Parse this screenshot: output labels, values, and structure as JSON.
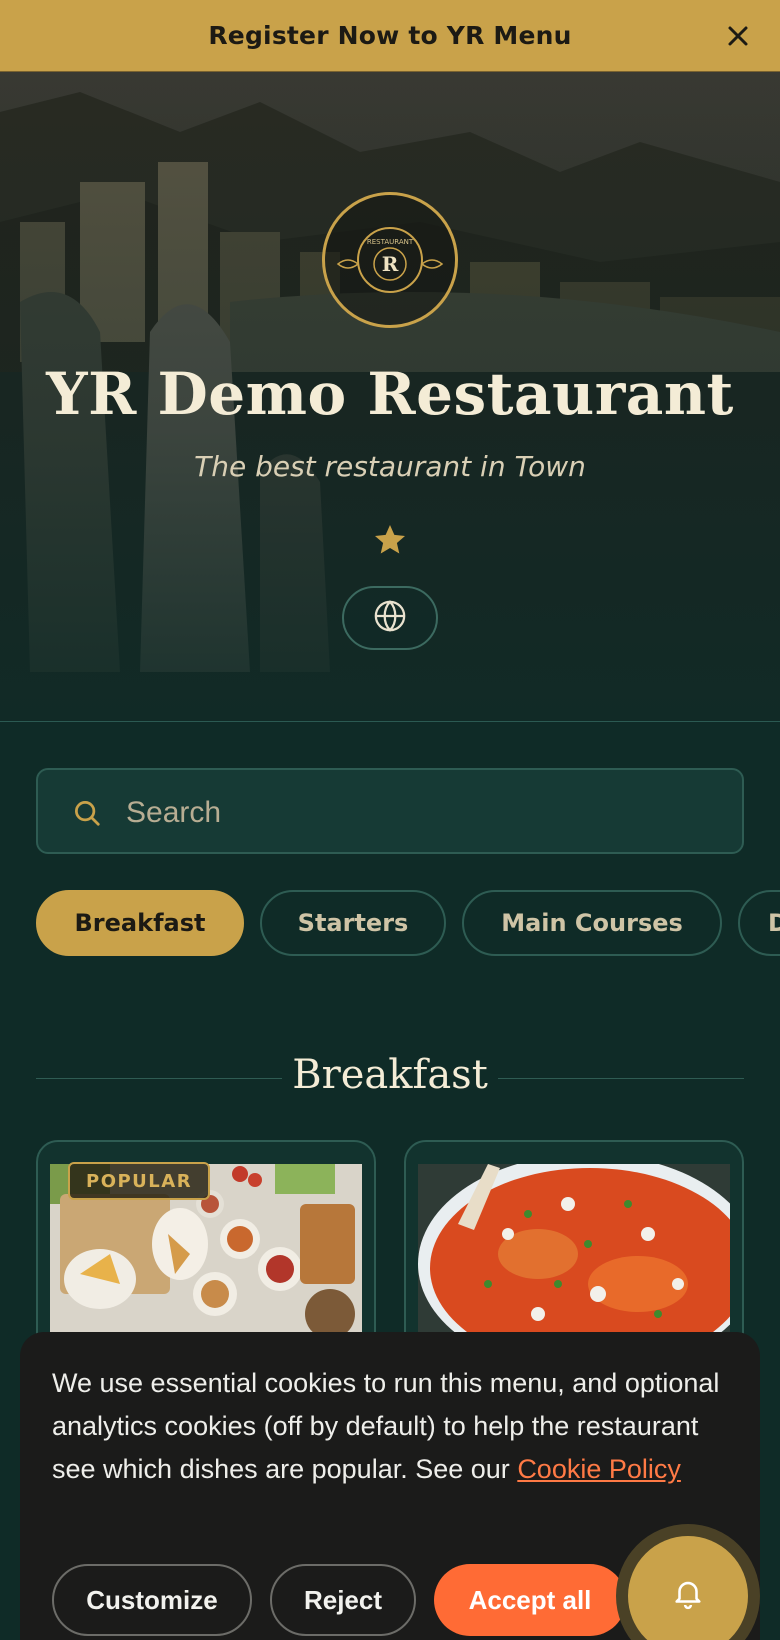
{
  "banner": {
    "text": "Register Now to YR Menu",
    "close_icon": "close-icon"
  },
  "hero": {
    "logo_text": "RESTAURANT",
    "logo_letter": "R",
    "title": "YR Demo Restaurant",
    "subtitle": "The best restaurant in Town",
    "star_icon": "star-icon",
    "language_icon": "globe-icon"
  },
  "search": {
    "placeholder": "Search",
    "value": ""
  },
  "categories": [
    {
      "label": "Breakfast",
      "active": true
    },
    {
      "label": "Starters",
      "active": false
    },
    {
      "label": "Main Courses",
      "active": false
    },
    {
      "label": "D",
      "active": false
    }
  ],
  "section": {
    "title": "Breakfast"
  },
  "cards": [
    {
      "badge": "POPULAR"
    },
    {
      "badge": ""
    }
  ],
  "cookie": {
    "text": "We use essential cookies to run this menu, and optional analytics cookies (off by default) to help the restaurant see which dishes are popular. See our",
    "link_text": "Cookie Policy",
    "customize_label": "Customize",
    "reject_label": "Reject",
    "accept_label": "Accept all"
  },
  "fab": {
    "icon": "bell-icon"
  },
  "colors": {
    "gold": "#c9a24a",
    "dark_green": "#0f2b27",
    "accent_orange": "#ff6b35",
    "cookie_bg": "#1b1b1a"
  }
}
